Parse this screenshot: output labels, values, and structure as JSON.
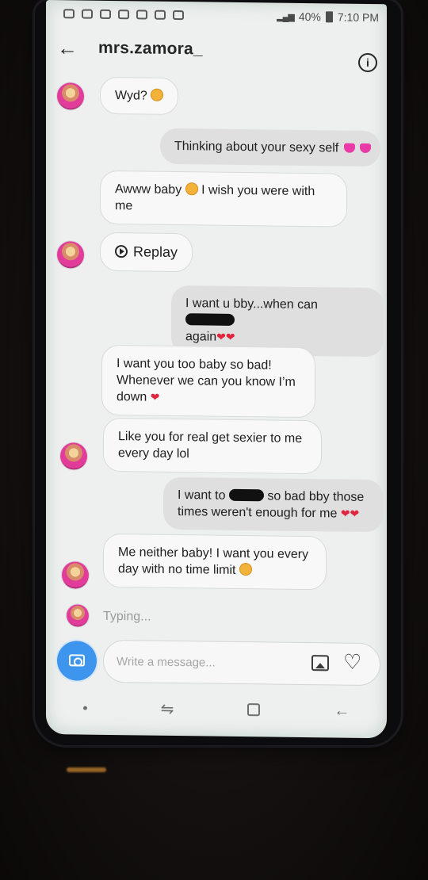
{
  "status_bar": {
    "battery": "40%",
    "time": "7:10 PM"
  },
  "header": {
    "title": "mrs.zamora_",
    "back_icon": "back-arrow-icon",
    "info_icon": "info-icon"
  },
  "messages": [
    {
      "from": "them",
      "text": "Wyd?"
    },
    {
      "from": "me",
      "text": "Thinking about your sexy self"
    },
    {
      "from": "them",
      "line1": "Awww baby",
      "line1b": "I wish you were with",
      "line2": "me"
    },
    {
      "from": "them",
      "type": "replay",
      "text": "Replay"
    },
    {
      "from": "me",
      "line1": "I want u bby...when can",
      "line2": "again"
    },
    {
      "from": "them",
      "line1": "I want you too baby so bad!",
      "line2": "Whenever we can you know I’m",
      "line3": "down"
    },
    {
      "from": "them",
      "line1": "Like you for real get sexier to me",
      "line2": "every day lol"
    },
    {
      "from": "me",
      "line1a": "I want to",
      "line1b": "so bad bby those",
      "line2": "times weren't enough for me"
    },
    {
      "from": "them",
      "line1": "Me neither baby! I want you every",
      "line2": "day with no time limit"
    }
  ],
  "typing": "Typing...",
  "composer": {
    "placeholder": "Write a message...",
    "camera_icon": "camera-icon",
    "gallery_icon": "gallery-icon",
    "like_icon": "heart-icon"
  },
  "colors": {
    "camera": "#3d95ee",
    "heart": "#e0263e",
    "incoming_bubble": "#f7f8f7",
    "outgoing_bubble": "#dedfde"
  }
}
